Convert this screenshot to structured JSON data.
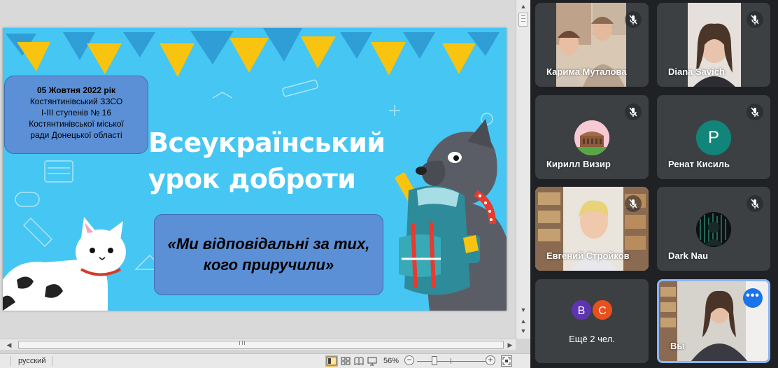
{
  "slide": {
    "title_line1": "Всеукраїнський",
    "title_line2": "урок доброти",
    "school": {
      "date": "05 Жовтня 2022 рік",
      "line2": "Костянтинівський ЗЗСО",
      "line3": "I-III ступенів № 16",
      "line4": "Костянтинівської міської",
      "line5": "ради Донецької області"
    },
    "quote_line1": "«Ми відповідальні за тих,",
    "quote_line2": "кого приручили»",
    "colors": {
      "background": "#46c6f2",
      "flag_yellow": "#f8c40f",
      "flag_blue": "#2f9ed6",
      "box_fill": "#5b8fd6"
    }
  },
  "status_bar": {
    "language": "русский",
    "zoom": "56%",
    "zoom_percent": 56,
    "views": [
      "normal-view-icon",
      "slide-sorter-icon",
      "reading-view-icon",
      "slideshow-icon"
    ]
  },
  "meet": {
    "participants": [
      {
        "name": "Карима Муталова",
        "type": "video",
        "muted": true
      },
      {
        "name": "Diana Savich",
        "type": "video",
        "muted": true
      },
      {
        "name": "Кирилл Визир",
        "type": "avatar-image",
        "muted": true
      },
      {
        "name": "Ренат Кисиль",
        "type": "initial",
        "initial": "P",
        "avatar_color": "#12857a",
        "muted": true
      },
      {
        "name": "Евгений Стройков",
        "type": "video",
        "muted": true
      },
      {
        "name": "Dark Nau",
        "type": "avatar-image",
        "muted": true
      },
      {
        "name": "Ещё 2 чел.",
        "type": "others",
        "initials": [
          "B",
          "C"
        ],
        "colors": [
          "#5e35b1",
          "#e8501e"
        ]
      },
      {
        "name": "Вы",
        "type": "video-self",
        "more_label": "•••"
      }
    ]
  }
}
